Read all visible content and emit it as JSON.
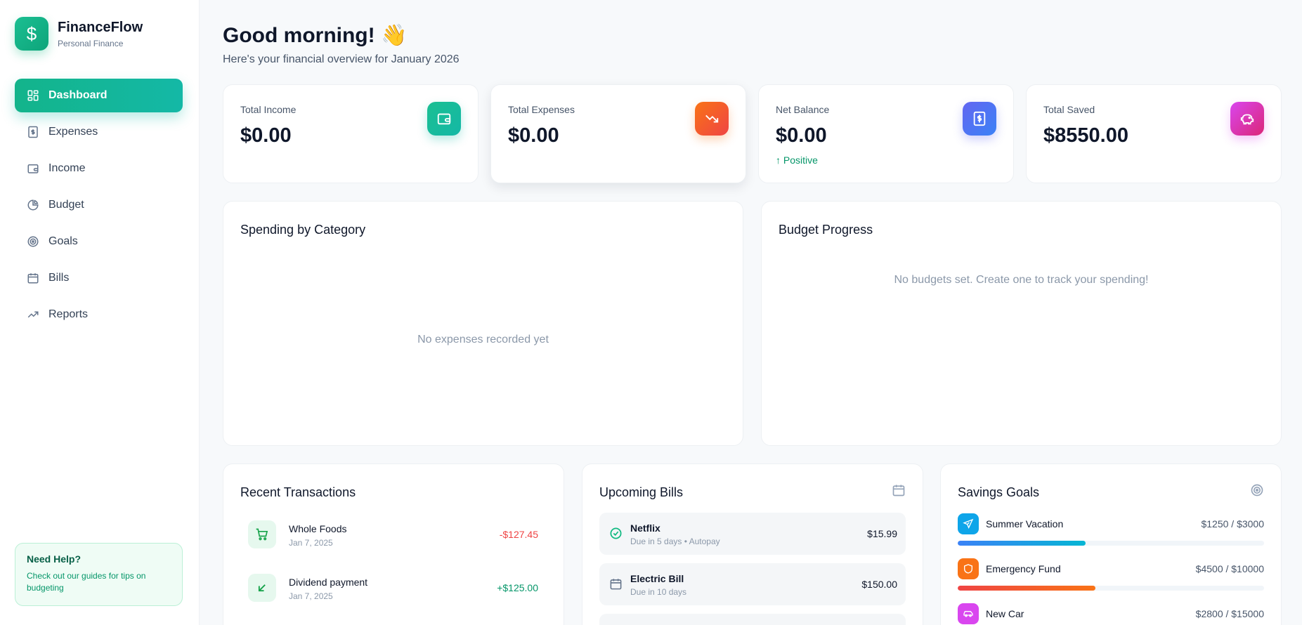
{
  "brand": {
    "name": "FinanceFlow",
    "subtitle": "Personal Finance"
  },
  "nav": [
    {
      "label": "Dashboard",
      "icon": "dashboard-icon",
      "active": true
    },
    {
      "label": "Expenses",
      "icon": "receipt-icon"
    },
    {
      "label": "Income",
      "icon": "wallet-icon"
    },
    {
      "label": "Budget",
      "icon": "pie-chart-icon"
    },
    {
      "label": "Goals",
      "icon": "target-icon"
    },
    {
      "label": "Bills",
      "icon": "calendar-icon"
    },
    {
      "label": "Reports",
      "icon": "trend-up-icon"
    }
  ],
  "help": {
    "title": "Need Help?",
    "text": "Check out our guides for tips on budgeting"
  },
  "header": {
    "greeting": "Good morning! 👋",
    "subtitle": "Here's your financial overview for January 2026"
  },
  "stats": [
    {
      "label": "Total Income",
      "value": "$0.00",
      "icon": "wallet-icon",
      "color": "#14b8a6"
    },
    {
      "label": "Total Expenses",
      "value": "$0.00",
      "icon": "trending-down-icon",
      "color": "#f97316"
    },
    {
      "label": "Net Balance",
      "value": "$0.00",
      "note": "↑ Positive",
      "icon": "dollar-receipt-icon",
      "color": "#5b6cf0"
    },
    {
      "label": "Total Saved",
      "value": "$8550.00",
      "icon": "piggy-bank-icon",
      "color": "#d946ef"
    }
  ],
  "spending": {
    "title": "Spending by Category",
    "empty": "No expenses recorded yet"
  },
  "budget": {
    "title": "Budget Progress",
    "empty": "No budgets set. Create one to track your spending!"
  },
  "transactions": {
    "title": "Recent Transactions",
    "items": [
      {
        "name": "Whole Foods",
        "date": "Jan 7, 2025",
        "amount": "-$127.45",
        "icon": "cart-icon",
        "color": "#ef4444"
      },
      {
        "name": "Dividend payment",
        "date": "Jan 7, 2025",
        "amount": "+$125.00",
        "icon": "arrow-down-left-icon",
        "color": "#059669"
      }
    ]
  },
  "bills": {
    "title": "Upcoming Bills",
    "items": [
      {
        "name": "Netflix",
        "sub": "Due in 5 days • Autopay",
        "amount": "$15.99",
        "icon": "check-circle-icon"
      },
      {
        "name": "Electric Bill",
        "sub": "Due in 10 days",
        "amount": "$150.00",
        "icon": "calendar-icon"
      }
    ]
  },
  "goals": {
    "title": "Savings Goals",
    "items": [
      {
        "name": "Summer Vacation",
        "amount": "$1250 / $3000",
        "progress": 0.4167,
        "icon": "plane-icon",
        "color": "#0ea5e9"
      },
      {
        "name": "Emergency Fund",
        "amount": "$4500 / $10000",
        "progress": 0.45,
        "icon": "shield-icon",
        "color": "#f97316"
      },
      {
        "name": "New Car",
        "amount": "$2800 / $15000",
        "progress": 0.1867,
        "icon": "car-icon",
        "color": "#d946ef"
      }
    ]
  }
}
